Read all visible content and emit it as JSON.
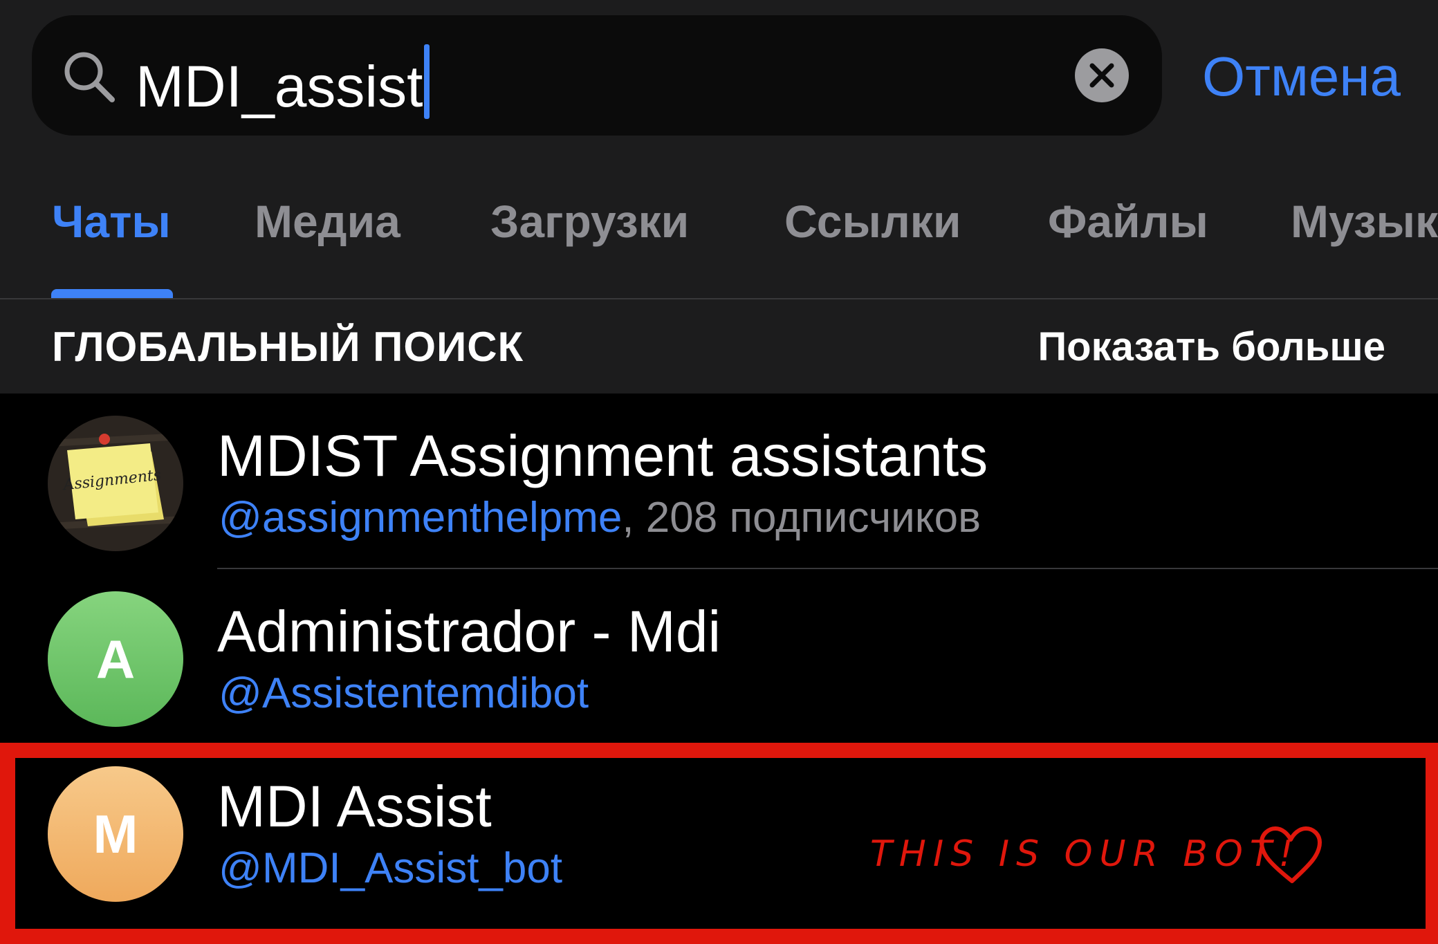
{
  "search": {
    "query": "MDI_assist",
    "cancel_label": "Отмена",
    "icon": "search-icon",
    "clear_icon": "clear-icon"
  },
  "tabs": [
    {
      "label": "Чаты",
      "active": true
    },
    {
      "label": "Медиа",
      "active": false
    },
    {
      "label": "Загрузки",
      "active": false
    },
    {
      "label": "Ссылки",
      "active": false
    },
    {
      "label": "Файлы",
      "active": false
    },
    {
      "label": "Музык",
      "active": false
    }
  ],
  "section": {
    "title": "ГЛОБАЛЬНЫЙ ПОИСК",
    "more_label": "Показать больше"
  },
  "results": [
    {
      "title": "MDIST Assignment assistants",
      "handle": "@assignmenthelpme",
      "meta": ", 208 подписчиков",
      "avatar_text": "Assignments"
    },
    {
      "title": "Administrador - Mdi",
      "handle": "@Assistentemdibot",
      "avatar_letter": "A",
      "avatar_color": "#6cc56a"
    },
    {
      "title": "MDI Assist",
      "handle": "@MDI_Assist_bot",
      "avatar_letter": "M",
      "avatar_color": "#f2b56c"
    }
  ],
  "annotation": {
    "text": "THIS IS OUR BOT!",
    "color": "#e0170c"
  },
  "colors": {
    "accent": "#3e82f7",
    "highlight": "#e0170c"
  }
}
